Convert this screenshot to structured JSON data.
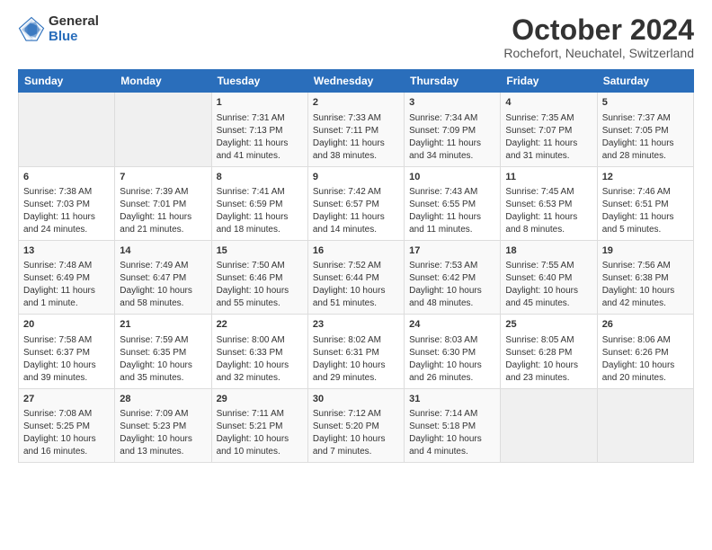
{
  "logo": {
    "general": "General",
    "blue": "Blue"
  },
  "header": {
    "title": "October 2024",
    "subtitle": "Rochefort, Neuchatel, Switzerland"
  },
  "weekdays": [
    "Sunday",
    "Monday",
    "Tuesday",
    "Wednesday",
    "Thursday",
    "Friday",
    "Saturday"
  ],
  "weeks": [
    [
      {
        "day": "",
        "sunrise": "",
        "sunset": "",
        "daylight": ""
      },
      {
        "day": "",
        "sunrise": "",
        "sunset": "",
        "daylight": ""
      },
      {
        "day": "1",
        "sunrise": "Sunrise: 7:31 AM",
        "sunset": "Sunset: 7:13 PM",
        "daylight": "Daylight: 11 hours and 41 minutes."
      },
      {
        "day": "2",
        "sunrise": "Sunrise: 7:33 AM",
        "sunset": "Sunset: 7:11 PM",
        "daylight": "Daylight: 11 hours and 38 minutes."
      },
      {
        "day": "3",
        "sunrise": "Sunrise: 7:34 AM",
        "sunset": "Sunset: 7:09 PM",
        "daylight": "Daylight: 11 hours and 34 minutes."
      },
      {
        "day": "4",
        "sunrise": "Sunrise: 7:35 AM",
        "sunset": "Sunset: 7:07 PM",
        "daylight": "Daylight: 11 hours and 31 minutes."
      },
      {
        "day": "5",
        "sunrise": "Sunrise: 7:37 AM",
        "sunset": "Sunset: 7:05 PM",
        "daylight": "Daylight: 11 hours and 28 minutes."
      }
    ],
    [
      {
        "day": "6",
        "sunrise": "Sunrise: 7:38 AM",
        "sunset": "Sunset: 7:03 PM",
        "daylight": "Daylight: 11 hours and 24 minutes."
      },
      {
        "day": "7",
        "sunrise": "Sunrise: 7:39 AM",
        "sunset": "Sunset: 7:01 PM",
        "daylight": "Daylight: 11 hours and 21 minutes."
      },
      {
        "day": "8",
        "sunrise": "Sunrise: 7:41 AM",
        "sunset": "Sunset: 6:59 PM",
        "daylight": "Daylight: 11 hours and 18 minutes."
      },
      {
        "day": "9",
        "sunrise": "Sunrise: 7:42 AM",
        "sunset": "Sunset: 6:57 PM",
        "daylight": "Daylight: 11 hours and 14 minutes."
      },
      {
        "day": "10",
        "sunrise": "Sunrise: 7:43 AM",
        "sunset": "Sunset: 6:55 PM",
        "daylight": "Daylight: 11 hours and 11 minutes."
      },
      {
        "day": "11",
        "sunrise": "Sunrise: 7:45 AM",
        "sunset": "Sunset: 6:53 PM",
        "daylight": "Daylight: 11 hours and 8 minutes."
      },
      {
        "day": "12",
        "sunrise": "Sunrise: 7:46 AM",
        "sunset": "Sunset: 6:51 PM",
        "daylight": "Daylight: 11 hours and 5 minutes."
      }
    ],
    [
      {
        "day": "13",
        "sunrise": "Sunrise: 7:48 AM",
        "sunset": "Sunset: 6:49 PM",
        "daylight": "Daylight: 11 hours and 1 minute."
      },
      {
        "day": "14",
        "sunrise": "Sunrise: 7:49 AM",
        "sunset": "Sunset: 6:47 PM",
        "daylight": "Daylight: 10 hours and 58 minutes."
      },
      {
        "day": "15",
        "sunrise": "Sunrise: 7:50 AM",
        "sunset": "Sunset: 6:46 PM",
        "daylight": "Daylight: 10 hours and 55 minutes."
      },
      {
        "day": "16",
        "sunrise": "Sunrise: 7:52 AM",
        "sunset": "Sunset: 6:44 PM",
        "daylight": "Daylight: 10 hours and 51 minutes."
      },
      {
        "day": "17",
        "sunrise": "Sunrise: 7:53 AM",
        "sunset": "Sunset: 6:42 PM",
        "daylight": "Daylight: 10 hours and 48 minutes."
      },
      {
        "day": "18",
        "sunrise": "Sunrise: 7:55 AM",
        "sunset": "Sunset: 6:40 PM",
        "daylight": "Daylight: 10 hours and 45 minutes."
      },
      {
        "day": "19",
        "sunrise": "Sunrise: 7:56 AM",
        "sunset": "Sunset: 6:38 PM",
        "daylight": "Daylight: 10 hours and 42 minutes."
      }
    ],
    [
      {
        "day": "20",
        "sunrise": "Sunrise: 7:58 AM",
        "sunset": "Sunset: 6:37 PM",
        "daylight": "Daylight: 10 hours and 39 minutes."
      },
      {
        "day": "21",
        "sunrise": "Sunrise: 7:59 AM",
        "sunset": "Sunset: 6:35 PM",
        "daylight": "Daylight: 10 hours and 35 minutes."
      },
      {
        "day": "22",
        "sunrise": "Sunrise: 8:00 AM",
        "sunset": "Sunset: 6:33 PM",
        "daylight": "Daylight: 10 hours and 32 minutes."
      },
      {
        "day": "23",
        "sunrise": "Sunrise: 8:02 AM",
        "sunset": "Sunset: 6:31 PM",
        "daylight": "Daylight: 10 hours and 29 minutes."
      },
      {
        "day": "24",
        "sunrise": "Sunrise: 8:03 AM",
        "sunset": "Sunset: 6:30 PM",
        "daylight": "Daylight: 10 hours and 26 minutes."
      },
      {
        "day": "25",
        "sunrise": "Sunrise: 8:05 AM",
        "sunset": "Sunset: 6:28 PM",
        "daylight": "Daylight: 10 hours and 23 minutes."
      },
      {
        "day": "26",
        "sunrise": "Sunrise: 8:06 AM",
        "sunset": "Sunset: 6:26 PM",
        "daylight": "Daylight: 10 hours and 20 minutes."
      }
    ],
    [
      {
        "day": "27",
        "sunrise": "Sunrise: 7:08 AM",
        "sunset": "Sunset: 5:25 PM",
        "daylight": "Daylight: 10 hours and 16 minutes."
      },
      {
        "day": "28",
        "sunrise": "Sunrise: 7:09 AM",
        "sunset": "Sunset: 5:23 PM",
        "daylight": "Daylight: 10 hours and 13 minutes."
      },
      {
        "day": "29",
        "sunrise": "Sunrise: 7:11 AM",
        "sunset": "Sunset: 5:21 PM",
        "daylight": "Daylight: 10 hours and 10 minutes."
      },
      {
        "day": "30",
        "sunrise": "Sunrise: 7:12 AM",
        "sunset": "Sunset: 5:20 PM",
        "daylight": "Daylight: 10 hours and 7 minutes."
      },
      {
        "day": "31",
        "sunrise": "Sunrise: 7:14 AM",
        "sunset": "Sunset: 5:18 PM",
        "daylight": "Daylight: 10 hours and 4 minutes."
      },
      {
        "day": "",
        "sunrise": "",
        "sunset": "",
        "daylight": ""
      },
      {
        "day": "",
        "sunrise": "",
        "sunset": "",
        "daylight": ""
      }
    ]
  ]
}
